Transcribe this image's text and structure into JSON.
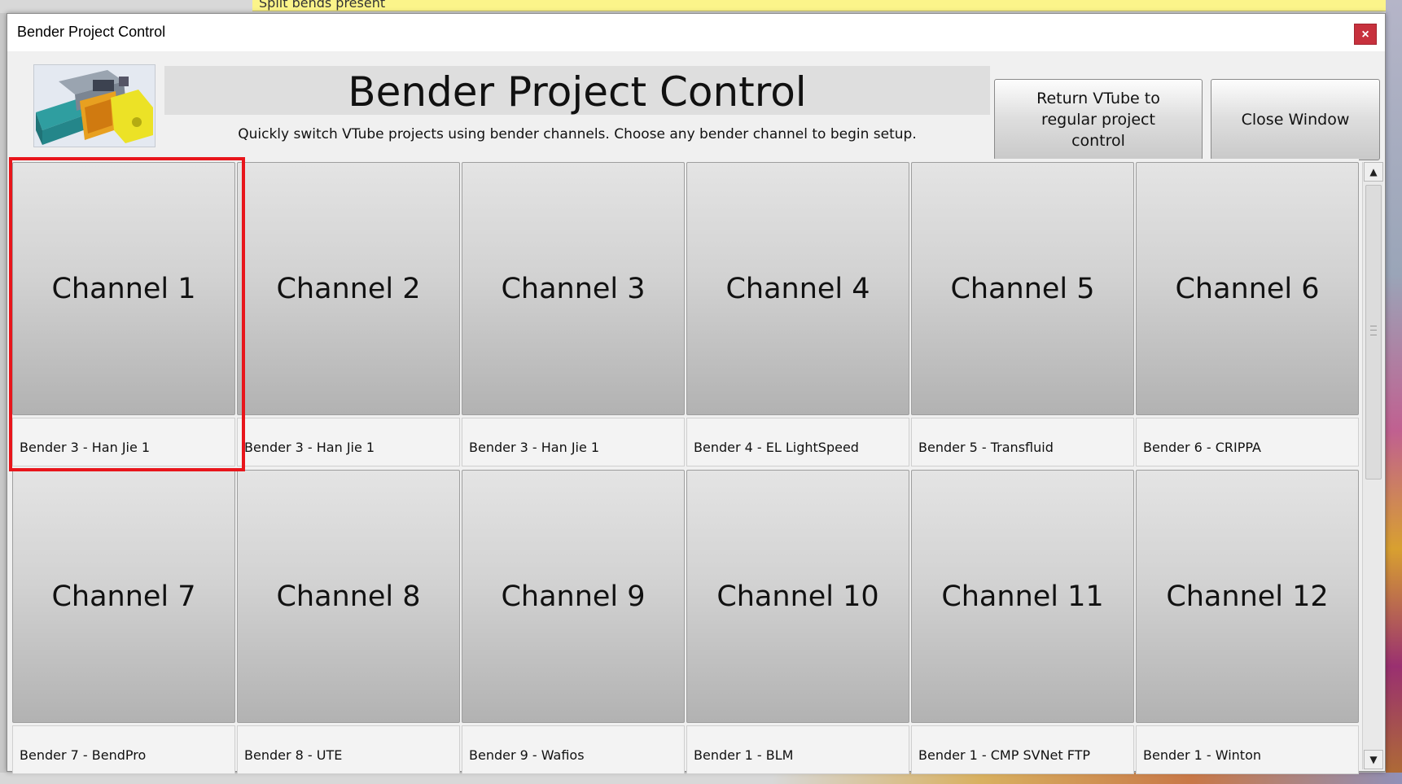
{
  "background": {
    "banner_text": "Split bends present"
  },
  "window": {
    "title": "Bender Project Control",
    "close_glyph": "×"
  },
  "header": {
    "title": "Bender Project Control",
    "subtitle": "Quickly switch VTube projects using bender channels. Choose any bender channel to begin setup.",
    "return_button": "Return VTube to regular project control",
    "close_button": "Close Window",
    "logo_icon": "tube-bender-machine-image"
  },
  "channels": [
    {
      "name": "Channel 1",
      "bender": "Bender 3 - Han Jie 1"
    },
    {
      "name": "Channel 2",
      "bender": "Bender 3 - Han Jie 1"
    },
    {
      "name": "Channel 3",
      "bender": "Bender 3 - Han Jie 1"
    },
    {
      "name": "Channel 4",
      "bender": "Bender 4 - EL LightSpeed"
    },
    {
      "name": "Channel 5",
      "bender": "Bender 5 - Transfluid"
    },
    {
      "name": "Channel 6",
      "bender": "Bender 6 - CRIPPA"
    },
    {
      "name": "Channel 7",
      "bender": "Bender 7 - BendPro"
    },
    {
      "name": "Channel 8",
      "bender": "Bender 8 - UTE"
    },
    {
      "name": "Channel 9",
      "bender": "Bender 9 - Wafios"
    },
    {
      "name": "Channel 10",
      "bender": "Bender 1 - BLM"
    },
    {
      "name": "Channel 11",
      "bender": "Bender 1 - CMP SVNet FTP"
    },
    {
      "name": "Channel 12",
      "bender": "Bender 1 - Winton"
    }
  ],
  "highlighted_channel": "Channel 1",
  "scrollbar": {
    "up_icon": "scroll-up-arrow-icon",
    "down_icon": "scroll-down-arrow-icon"
  },
  "colors": {
    "highlight": "#e8151b",
    "close_button": "#c7313d"
  }
}
